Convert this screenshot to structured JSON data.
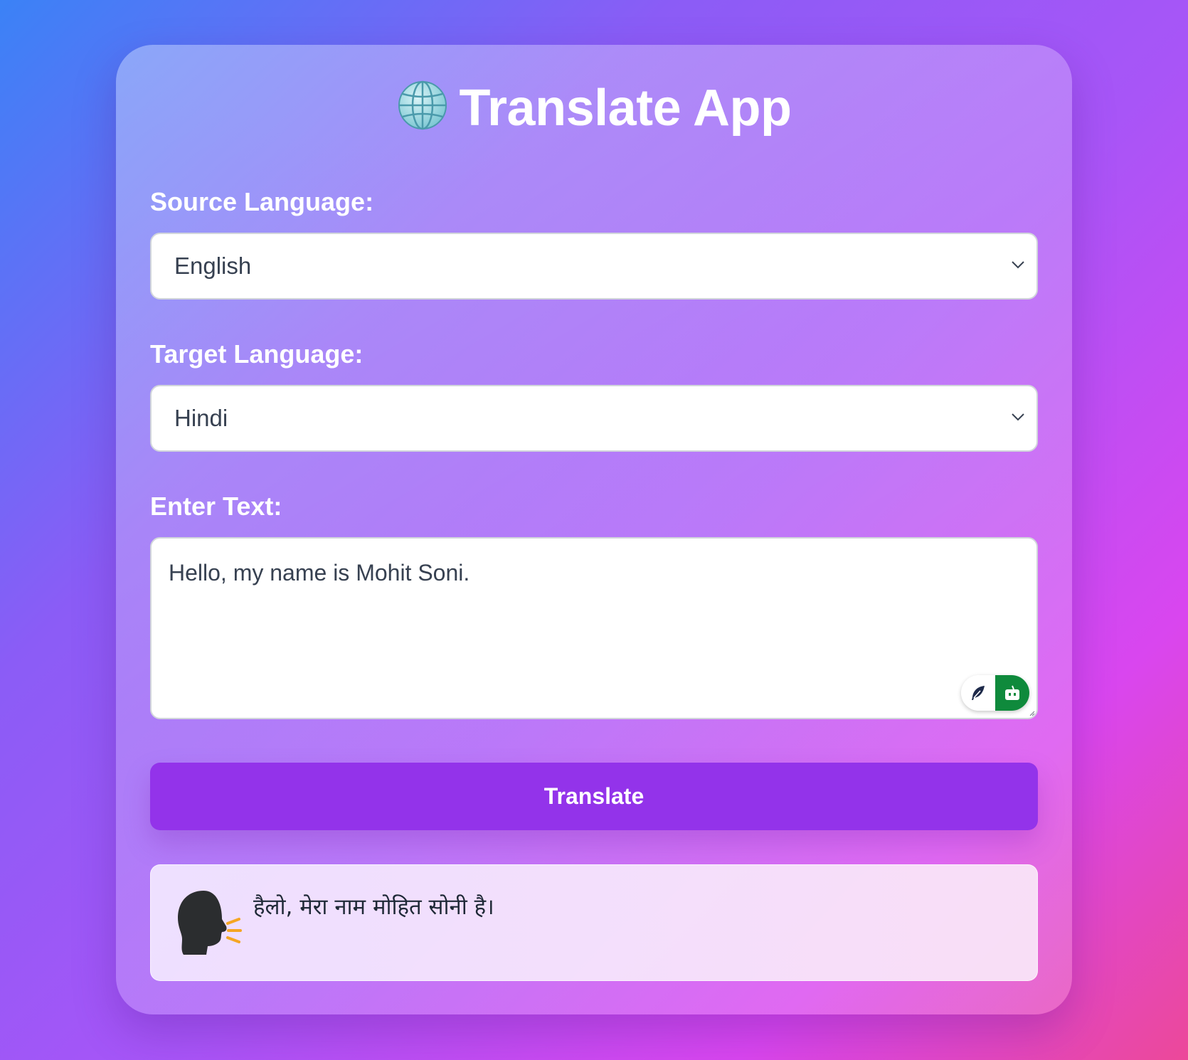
{
  "app": {
    "title": "Translate App",
    "title_icon": "globe-icon"
  },
  "form": {
    "source_label": "Source Language:",
    "source_value": "English",
    "target_label": "Target Language:",
    "target_value": "Hindi",
    "text_label": "Enter Text:",
    "text_value": "Hello, my name is Mohit Soni.",
    "translate_button": "Translate"
  },
  "result": {
    "icon": "speaking-head-icon",
    "text": "हैलो, मेरा नाम मोहित सोनी है।"
  },
  "extension_widget": {
    "left_icon": "feather-icon",
    "right_icon": "robot-icon"
  },
  "colors": {
    "accent": "#9333ea",
    "extension_green": "#0f8a3c",
    "background_start": "#3b82f6",
    "background_end": "#ec4899"
  }
}
